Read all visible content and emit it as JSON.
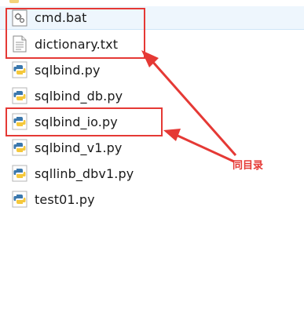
{
  "files": [
    {
      "name": "cmd.bat",
      "icon": "batch-file-icon",
      "selected": true
    },
    {
      "name": "dictionary.txt",
      "icon": "text-file-icon",
      "selected": false
    },
    {
      "name": "sqlbind.py",
      "icon": "python-file-icon",
      "selected": false
    },
    {
      "name": "sqlbind_db.py",
      "icon": "python-file-icon",
      "selected": false
    },
    {
      "name": "sqlbind_io.py",
      "icon": "python-file-icon",
      "selected": false
    },
    {
      "name": "sqlbind_v1.py",
      "icon": "python-file-icon",
      "selected": false
    },
    {
      "name": "sqllinb_dbv1.py",
      "icon": "python-file-icon",
      "selected": false
    },
    {
      "name": "test01.py",
      "icon": "python-file-icon",
      "selected": false
    }
  ],
  "annotation": {
    "label": "同目录",
    "color": "#e53935"
  }
}
